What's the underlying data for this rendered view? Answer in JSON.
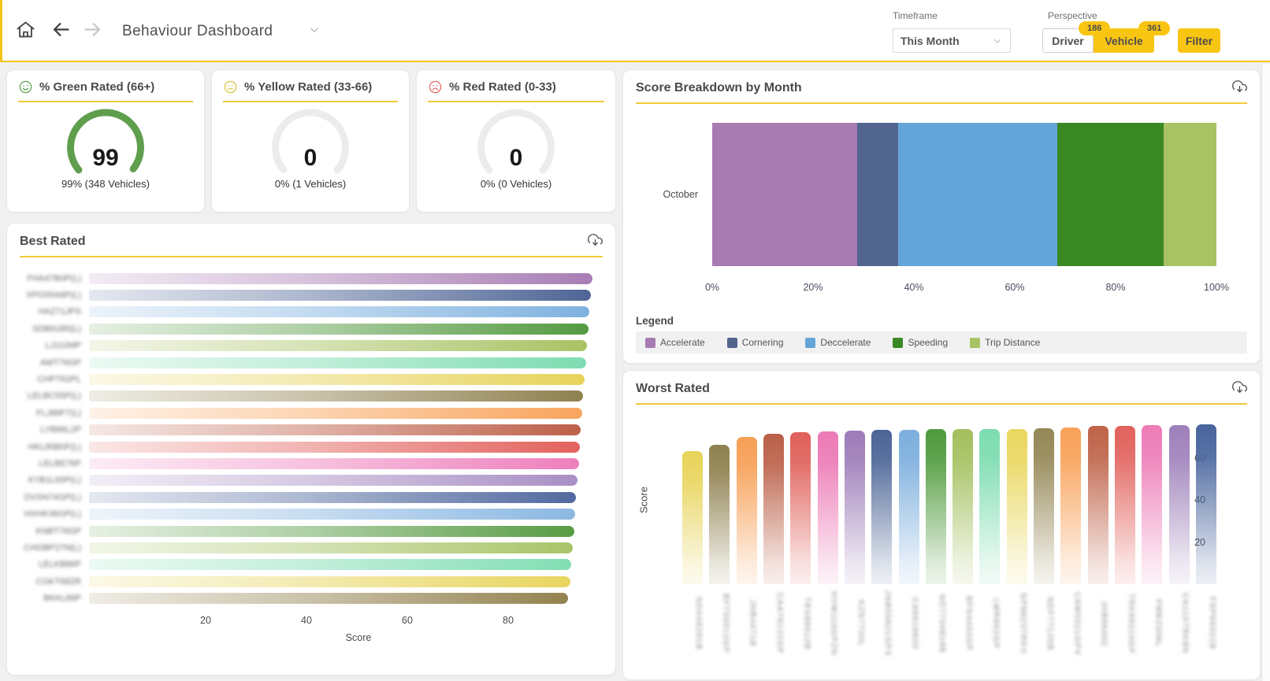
{
  "app": {
    "accent_gold": "#F9C513",
    "rule_yellow": "#F2CA3A",
    "topbar_border": "#F5C518",
    "page_bg": "#f0f0f0"
  },
  "icons": {
    "home-icon": "house outline",
    "back-icon": "left arrow (enabled)",
    "forward-icon": "right arrow (disabled)",
    "chevron-down-icon": "collapsed dropdown caret",
    "cloud-download-icon": "cloud with downward arrow (export)",
    "face-happy-icon": "green smiling face",
    "face-neutral-icon": "yellow neutral face",
    "face-sad-icon": "red sad face"
  },
  "topbar": {
    "title": "Behaviour Dashboard",
    "timeframe": {
      "label": "Timeframe",
      "value": "This Month"
    },
    "perspective": {
      "label": "Perspective",
      "driver": {
        "label": "Driver",
        "badge": "186",
        "selected": false
      },
      "vehicle": {
        "label": "Vehicle",
        "badge": "361",
        "selected": true
      }
    },
    "filter_label": "Filter"
  },
  "gauges": [
    {
      "title": "% Green Rated (66+)",
      "icon": "face-happy-icon",
      "icon_color": "#5f9e4d",
      "value": 99,
      "display_value": "99",
      "subtitle": "99% (348 Vehicles)",
      "color": "#5f9e4d"
    },
    {
      "title": "% Yellow Rated (33-66)",
      "icon": "face-neutral-icon",
      "icon_color": "#d9c43c",
      "value": 0,
      "display_value": "0",
      "subtitle": "0% (1 Vehicles)",
      "color": "#d9c43c"
    },
    {
      "title": "% Red Rated (0-33)",
      "icon": "face-sad-icon",
      "icon_color": "#e06a63",
      "value": 0,
      "display_value": "0",
      "subtitle": "0% (0 Vehicles)",
      "color": "#e06a63"
    }
  ],
  "sections": {
    "best_rated_title": "Best Rated",
    "score_breakdown_title": "Score Breakdown by Month",
    "worst_rated_title": "Worst Rated",
    "legend_title": "Legend"
  },
  "chart_data": [
    {
      "id": "best_rated",
      "type": "bar",
      "orientation": "horizontal",
      "title": "Best Rated",
      "xlabel": "Score",
      "xlim": [
        0,
        100
      ],
      "xticks": [
        20,
        40,
        60,
        80
      ],
      "categories_blurred": true,
      "categories": [
        "FHA47B0P(L)",
        "XPG55A6P(L)",
        "HAZ71JPS",
        "SDB61B5(L)",
        "LJ110MP",
        "AWT76GP",
        "CHPT62PL",
        "LELBC55P(L)",
        "FLJ88F7(L)",
        "LYB86L2P",
        "HKL85B0F(L)",
        "LELBE76P",
        "KYB1L65P(L)",
        "DVSN74GP(L)",
        "HXHK36GP(L)",
        "KNBT76GP",
        "CHGBP27N(L)",
        "LELKB86P",
        "CGKT68ZR",
        "BKKL86P"
      ],
      "values": [
        96.2,
        96.0,
        95.7,
        95.5,
        95.2,
        95.0,
        94.8,
        94.5,
        94.3,
        94.0,
        93.8,
        93.6,
        93.3,
        93.1,
        92.9,
        92.7,
        92.5,
        92.2,
        92.0,
        91.6
      ],
      "colors": [
        "#a87db4",
        "#4f6596",
        "#7fb2e0",
        "#549a41",
        "#a9c364",
        "#7edcb2",
        "#e7d35b",
        "#8f8150",
        "#f9a55e",
        "#bd6049",
        "#e2615c",
        "#ee7fbc",
        "#a98fc4",
        "#51699f",
        "#8cb8e2",
        "#589c45",
        "#a9c468",
        "#82ddb4",
        "#e8d55e",
        "#93824f"
      ]
    },
    {
      "id": "score_breakdown",
      "type": "stacked-bar",
      "orientation": "horizontal",
      "title": "Score Breakdown by Month",
      "categories": [
        "October"
      ],
      "xticks": [
        "0%",
        "20%",
        "40%",
        "60%",
        "80%",
        "100%"
      ],
      "legend_position": "bottom",
      "series": [
        {
          "name": "Accelerate",
          "values": [
            28.7
          ],
          "color": "#a87cb2"
        },
        {
          "name": "Cornering",
          "values": [
            8.1
          ],
          "color": "#51658f"
        },
        {
          "name": "Deccelerate",
          "values": [
            31.6
          ],
          "color": "#64a5d9"
        },
        {
          "name": "Speeding",
          "values": [
            21.2
          ],
          "color": "#3a8824"
        },
        {
          "name": "Trip Distance",
          "values": [
            10.4
          ],
          "color": "#a9c364"
        }
      ]
    },
    {
      "id": "worst_rated",
      "type": "bar",
      "orientation": "vertical",
      "title": "Worst Rated",
      "ylabel": "Score",
      "ylim": [
        0,
        80
      ],
      "yticks": [
        20,
        40,
        60
      ],
      "categories_blurred": true,
      "categories": [
        "ND448291B",
        "BFT55012GP",
        "JNB4471B",
        "CAA79122GP",
        "TRX88012B",
        "HVW110GPZN",
        "KZN7720L",
        "JNB55821GPX",
        "CA6619920",
        "ND7734818B",
        "BFN4402GP",
        "LWR662GP",
        "GP8823TRKV",
        "NDF77120B",
        "CAW5521GPX",
        "JHB66402",
        "TRK99210GP",
        "PMB3308L",
        "CA110TRK8N",
        "FSP66021B"
      ],
      "values": [
        63,
        66,
        70,
        71.5,
        72,
        72.5,
        73,
        73.2,
        73.4,
        73.5,
        73.5,
        73.6,
        73.8,
        74,
        74.5,
        75,
        75.2,
        75.4,
        75.6,
        75.8
      ],
      "colors": [
        "#e8d45a",
        "#8f8150",
        "#f79f56",
        "#bb6048",
        "#e0605a",
        "#ec7ab5",
        "#9d7cb8",
        "#4b6496",
        "#7caedd",
        "#4f9a3d",
        "#a3c05e",
        "#7cdcb0",
        "#e9d75f",
        "#948655",
        "#f8a158",
        "#bf6349",
        "#e2625c",
        "#ed7cb7",
        "#9e80ba",
        "#47649c"
      ]
    }
  ]
}
